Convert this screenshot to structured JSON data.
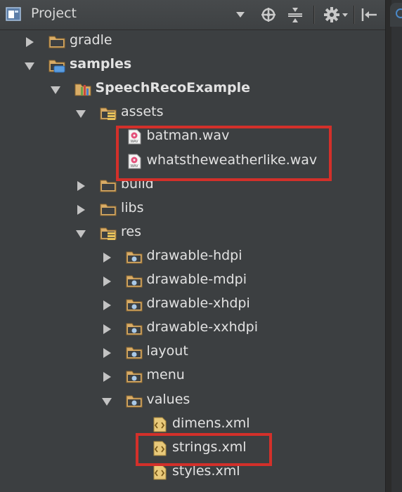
{
  "header": {
    "title": "Project",
    "icons": [
      "project-view-icon",
      "dropdown-arrow-icon",
      "locate-icon",
      "collapse-all-icon",
      "settings-gear-icon",
      "hide-panel-icon"
    ]
  },
  "colors": {
    "background": "#3c3f41",
    "folder": "#d3a560",
    "highlight": "#d3302a",
    "text": "#e2e2e2"
  },
  "tree": [
    {
      "label": "gradle",
      "depth": 0,
      "expanded": false,
      "icon": "folder-icon",
      "bold": false
    },
    {
      "label": "samples",
      "depth": 0,
      "expanded": true,
      "icon": "module-folder-icon",
      "bold": true
    },
    {
      "label": "SpeechRecoExample",
      "depth": 1,
      "expanded": true,
      "icon": "android-module-icon",
      "bold": true
    },
    {
      "label": "assets",
      "depth": 2,
      "expanded": true,
      "icon": "resource-folder-icon",
      "bold": false
    },
    {
      "label": "batman.wav",
      "depth": 3,
      "expanded": null,
      "icon": "wav-file-icon",
      "bold": false
    },
    {
      "label": "whatstheweatherlike.wav",
      "depth": 3,
      "expanded": null,
      "icon": "wav-file-icon",
      "bold": false
    },
    {
      "label": "build",
      "depth": 2,
      "expanded": false,
      "icon": "folder-icon",
      "bold": false
    },
    {
      "label": "libs",
      "depth": 2,
      "expanded": false,
      "icon": "folder-icon",
      "bold": false
    },
    {
      "label": "res",
      "depth": 2,
      "expanded": true,
      "icon": "resource-folder-icon",
      "bold": false
    },
    {
      "label": "drawable-hdpi",
      "depth": 3,
      "expanded": false,
      "icon": "package-folder-icon",
      "bold": false
    },
    {
      "label": "drawable-mdpi",
      "depth": 3,
      "expanded": false,
      "icon": "package-folder-icon",
      "bold": false
    },
    {
      "label": "drawable-xhdpi",
      "depth": 3,
      "expanded": false,
      "icon": "package-folder-icon",
      "bold": false
    },
    {
      "label": "drawable-xxhdpi",
      "depth": 3,
      "expanded": false,
      "icon": "package-folder-icon",
      "bold": false
    },
    {
      "label": "layout",
      "depth": 3,
      "expanded": false,
      "icon": "package-folder-icon",
      "bold": false
    },
    {
      "label": "menu",
      "depth": 3,
      "expanded": false,
      "icon": "package-folder-icon",
      "bold": false
    },
    {
      "label": "values",
      "depth": 3,
      "expanded": true,
      "icon": "package-folder-icon",
      "bold": false
    },
    {
      "label": "dimens.xml",
      "depth": 4,
      "expanded": null,
      "icon": "xml-file-icon",
      "bold": false
    },
    {
      "label": "strings.xml",
      "depth": 4,
      "expanded": null,
      "icon": "xml-file-icon",
      "bold": false
    },
    {
      "label": "styles.xml",
      "depth": 4,
      "expanded": null,
      "icon": "xml-file-icon",
      "bold": false
    }
  ]
}
